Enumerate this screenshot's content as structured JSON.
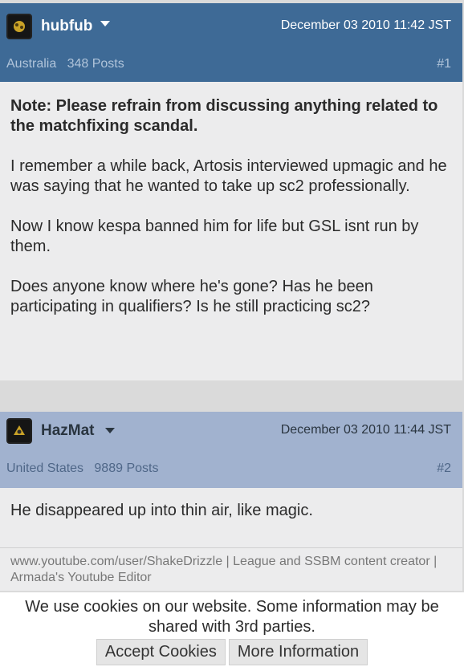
{
  "posts": [
    {
      "username": "hubfub",
      "date": "December 03 2010 11:42 JST",
      "location": "Australia",
      "posts_count": "348 Posts",
      "number": "#1",
      "bold_note": "Note: Please refrain from discussing anything related to the matchfixing scandal.",
      "paragraphs": [
        "I remember a while back, Artosis interviewed upmagic and he was saying that he wanted to take up sc2 professionally.",
        "Now I know kespa banned him for life but GSL isnt run by them.",
        "Does anyone know where he's gone? Has he been participating in qualifiers? Is he still practicing sc2?"
      ]
    },
    {
      "username": "HazMat",
      "date": "December 03 2010 11:44 JST",
      "location": "United States",
      "posts_count": "9889 Posts",
      "number": "#2",
      "paragraphs": [
        "He disappeared up into thin air, like magic."
      ],
      "signature": "www.youtube.com/user/ShakeDrizzle | League and SSBM content creator | Armada's Youtube Editor"
    }
  ],
  "cookie_banner": {
    "message": "We use cookies on our website. Some information may be shared with 3rd parties.",
    "accept_label": "Accept Cookies",
    "more_label": "More Information"
  }
}
